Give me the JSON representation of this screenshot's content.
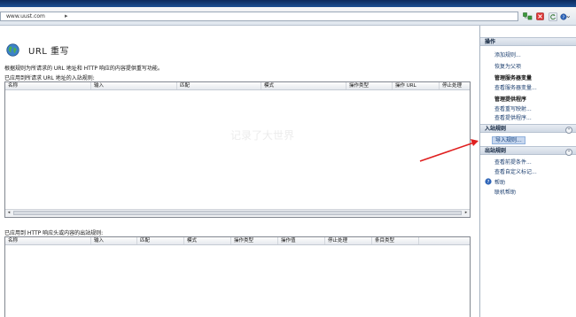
{
  "address_bar": {
    "url": "www.uust.com",
    "separator": "▸"
  },
  "nav_icons": [
    "network-icon",
    "stop-icon",
    "refresh-icon",
    "help-icon"
  ],
  "page": {
    "title": "URL 重写",
    "description": "根据规则为所请求的 URL 地址和 HTTP 响应的内容提供重写功能。",
    "inbound_label": "已应用到所请求 URL 地址的入站规则:",
    "outbound_label": "已应用到 HTTP 响应头或内容的出站规则:",
    "watermark": "记录了大世界"
  },
  "inbound_table": {
    "columns": [
      "名称",
      "输入",
      "匹配",
      "模式",
      "操作类型",
      "操作 URL",
      "停止处理"
    ],
    "rows": []
  },
  "outbound_table": {
    "columns": [
      "名称",
      "输入",
      "匹配",
      "模式",
      "操作类型",
      "操作值",
      "停止处理",
      "条目类型"
    ],
    "rows": []
  },
  "actions_pane": {
    "header": "操作",
    "add_rule": "添加规则...",
    "revert_parent": "恢复为父项",
    "server_vars_heading": "管理服务器变量",
    "view_server_vars": "查看服务器变量...",
    "providers_heading": "管理提供程序",
    "view_rewrite_maps": "查看重写映射...",
    "view_providers": "查看提供程序...",
    "inbound_header": "入站规则",
    "import_rules": "导入规则...",
    "outbound_header": "出站规则",
    "view_preconditions": "查看前提条件...",
    "view_custom_tags": "查看自定义标记...",
    "help": "帮助",
    "online_help": "联机帮助"
  },
  "colors": {
    "accent": "#1c4f93",
    "arrow": "#e02020",
    "selected": "#c7d7ee"
  }
}
